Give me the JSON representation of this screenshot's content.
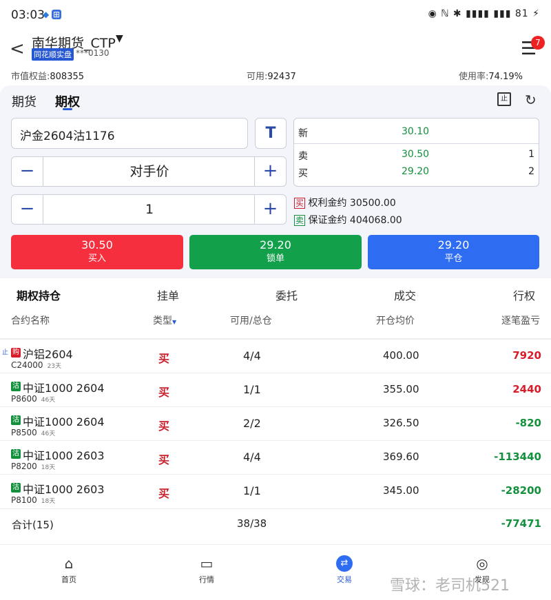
{
  "status": {
    "time": "03:03",
    "right": "◉ ℕ ✱ ▮▮▮▮ ▮▮▮ 81 ⚡"
  },
  "header": {
    "account": "南华期货_CTP",
    "broker_badge": "同花顺实盘",
    "account_no": "***0130",
    "notif_count": "7"
  },
  "summary": {
    "equity_label": "市值权益:",
    "equity": "808355",
    "avail_label": "可用:",
    "avail": "92437",
    "usage_label": "使用率:",
    "usage": "74.19%"
  },
  "tabs": {
    "futures": "期货",
    "options": "期权"
  },
  "order": {
    "contract": "沪金2604沽1176",
    "price_type": "对手价",
    "qty": "1",
    "t_label": "T"
  },
  "quote": {
    "new_label": "新",
    "new": "30.10",
    "sell_label": "卖",
    "sell": "30.50",
    "sell_vol": "1",
    "buy_label": "买",
    "buy": "29.20",
    "buy_vol": "2"
  },
  "margin": {
    "buy_tag": "买",
    "premium_label": "权利金约",
    "premium": "30500.00",
    "sell_tag": "卖",
    "margin_label": "保证金约",
    "margin": "404068.00"
  },
  "buttons": {
    "buy_price": "30.50",
    "buy_label": "买入",
    "lock_price": "29.20",
    "lock_label": "锁单",
    "close_price": "29.20",
    "close_label": "平仓"
  },
  "subtabs": [
    "期权持仓",
    "挂单",
    "委托",
    "成交",
    "行权"
  ],
  "table": {
    "headers": {
      "name": "合约名称",
      "type": "类型",
      "avail": "可用/总仓",
      "price": "开仓均价",
      "pnl": "逐笔盈亏"
    },
    "rows": [
      {
        "tag": "购",
        "name": "沪铝2604",
        "strike": "C24000",
        "days": "23天",
        "type": "买",
        "avail": "4/4",
        "price": "400.00",
        "pnl": "7920",
        "pos": true
      },
      {
        "tag": "沽",
        "name": "中证1000 2604",
        "strike": "P8600",
        "days": "46天",
        "type": "买",
        "avail": "1/1",
        "price": "355.00",
        "pnl": "2440",
        "pos": true
      },
      {
        "tag": "沽",
        "name": "中证1000 2604",
        "strike": "P8500",
        "days": "46天",
        "type": "买",
        "avail": "2/2",
        "price": "326.50",
        "pnl": "-820",
        "pos": false
      },
      {
        "tag": "沽",
        "name": "中证1000 2603",
        "strike": "P8200",
        "days": "18天",
        "type": "买",
        "avail": "4/4",
        "price": "369.60",
        "pnl": "-113440",
        "pos": false
      },
      {
        "tag": "沽",
        "name": "中证1000 2603",
        "strike": "P8100",
        "days": "18天",
        "type": "买",
        "avail": "1/1",
        "price": "345.00",
        "pnl": "-28200",
        "pos": false
      }
    ],
    "total_label": "合计(15)",
    "total_avail": "38/38",
    "total_pnl": "-77471"
  },
  "nav": [
    "首页",
    "行情",
    "交易",
    "发现"
  ],
  "watermark": "雪球：老司机521",
  "colors": {
    "red": "#f52f3e",
    "green": "#12a04a",
    "blue": "#2e6cf2",
    "up": "#d91c2a",
    "down": "#12903c"
  }
}
